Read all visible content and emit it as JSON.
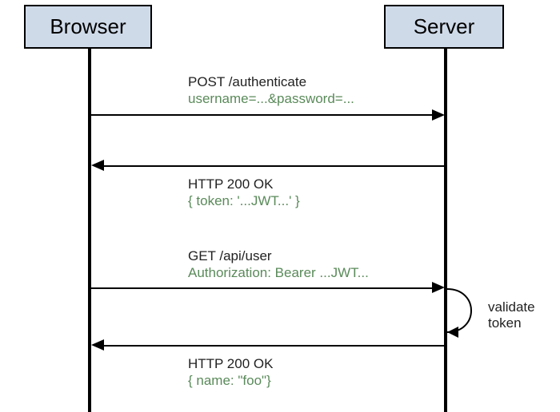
{
  "participants": {
    "browser": {
      "label": "Browser"
    },
    "server": {
      "label": "Server"
    }
  },
  "messages": {
    "m1": {
      "line1": "POST /authenticate",
      "line2": "username=...&password=..."
    },
    "m2": {
      "line1": "HTTP 200 OK",
      "line2": "{ token: '...JWT...' }"
    },
    "m3": {
      "line1": "GET /api/user",
      "line2": "Authorization: Bearer ...JWT..."
    },
    "m4": {
      "line1": "HTTP 200 OK",
      "line2": "{ name: \"foo\"}"
    }
  },
  "self": {
    "validate": {
      "line1": "validate",
      "line2": "token"
    }
  }
}
